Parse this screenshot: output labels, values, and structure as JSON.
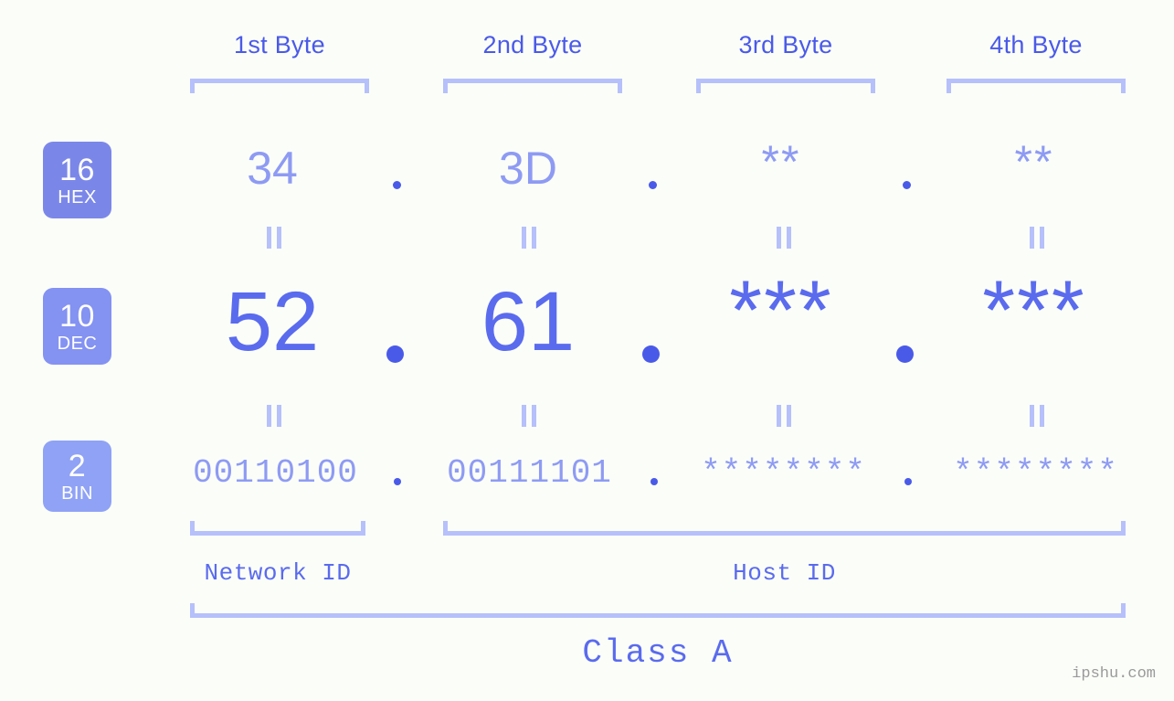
{
  "meta": {
    "background_color": "#fbfdf9",
    "accent_strong": "#4a5ae8",
    "accent_mid": "#5a6bee",
    "accent_light": "#8e9bf3",
    "accent_pale": "#b6c0fa",
    "badge_hex_color": "#7b87e8",
    "badge_dec_color": "#8492f2",
    "badge_bin_color": "#8fa2f5"
  },
  "headers": [
    {
      "label": "1st Byte"
    },
    {
      "label": "2nd Byte"
    },
    {
      "label": "3rd Byte"
    },
    {
      "label": "4th Byte"
    }
  ],
  "badges": [
    {
      "num": "16",
      "radix": "HEX"
    },
    {
      "num": "10",
      "radix": "DEC"
    },
    {
      "num": "2",
      "radix": "BIN"
    }
  ],
  "rows": {
    "hex": {
      "bytes": [
        "34",
        "3D",
        "**",
        "**"
      ],
      "separator": "."
    },
    "dec": {
      "bytes": [
        "52",
        "61",
        "***",
        "***"
      ],
      "separator": "."
    },
    "bin": {
      "bytes": [
        "00110100",
        "00111101",
        "********",
        "********"
      ],
      "separator": "."
    }
  },
  "equivalence_mark": "=",
  "sections": [
    {
      "label": "Network ID"
    },
    {
      "label": "Host ID"
    }
  ],
  "class": {
    "label": "Class A"
  },
  "watermark": {
    "text": "ipshu.com"
  }
}
